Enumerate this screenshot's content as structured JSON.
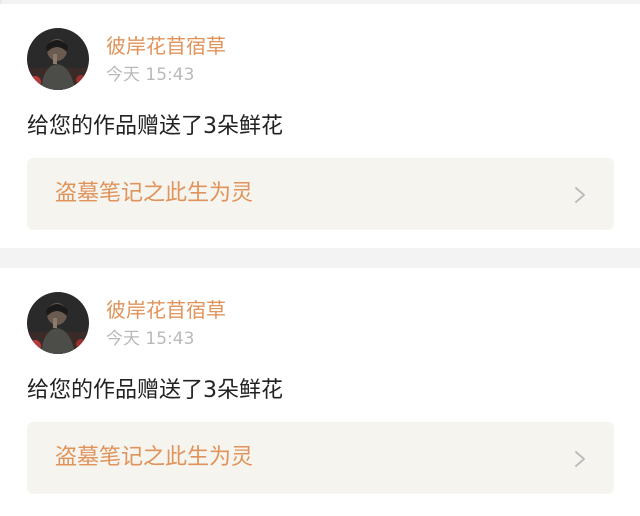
{
  "notifications": [
    {
      "username": "彼岸花苜宿草",
      "timestamp": "今天 15:43",
      "message": "给您的作品赠送了3朵鲜花",
      "work_title": "盗墓笔记之此生为灵",
      "avatar_icon": "user-avatar-photo",
      "chevron_icon": "chevron-right-icon"
    },
    {
      "username": "彼岸花苜宿草",
      "timestamp": "今天 15:43",
      "message": "给您的作品赠送了3朵鲜花",
      "work_title": "盗墓笔记之此生为灵",
      "avatar_icon": "user-avatar-photo",
      "chevron_icon": "chevron-right-icon"
    }
  ],
  "colors": {
    "accent": "#e0935a",
    "timestamp": "#b9b9b9",
    "message": "#222222",
    "link_background": "#f5f4ef",
    "separator": "#f3f3f3"
  }
}
